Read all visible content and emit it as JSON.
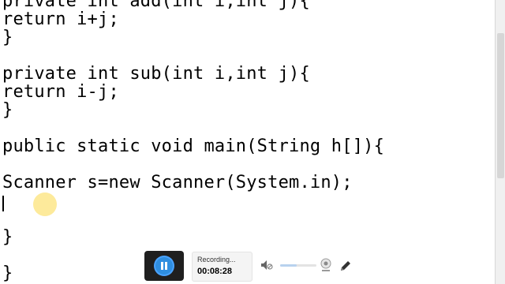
{
  "editor": {
    "lines": [
      "private int add(int i,int j){",
      "return i+j;",
      "}",
      "",
      "private int sub(int i,int j){",
      "return i-j;",
      "}",
      "",
      "public static void main(String h[]){",
      "",
      "Scanner s=new Scanner(System.in);",
      "",
      "",
      "}",
      "",
      "}"
    ]
  },
  "recorder": {
    "status": "Recording...",
    "elapsed": "00:08:28",
    "volume_level": 0.45,
    "icons": {
      "pause": "pause-icon",
      "speaker": "speaker-icon",
      "webcam": "webcam-icon",
      "pen": "pen-icon"
    },
    "accent_color": "#2f8ee0"
  }
}
